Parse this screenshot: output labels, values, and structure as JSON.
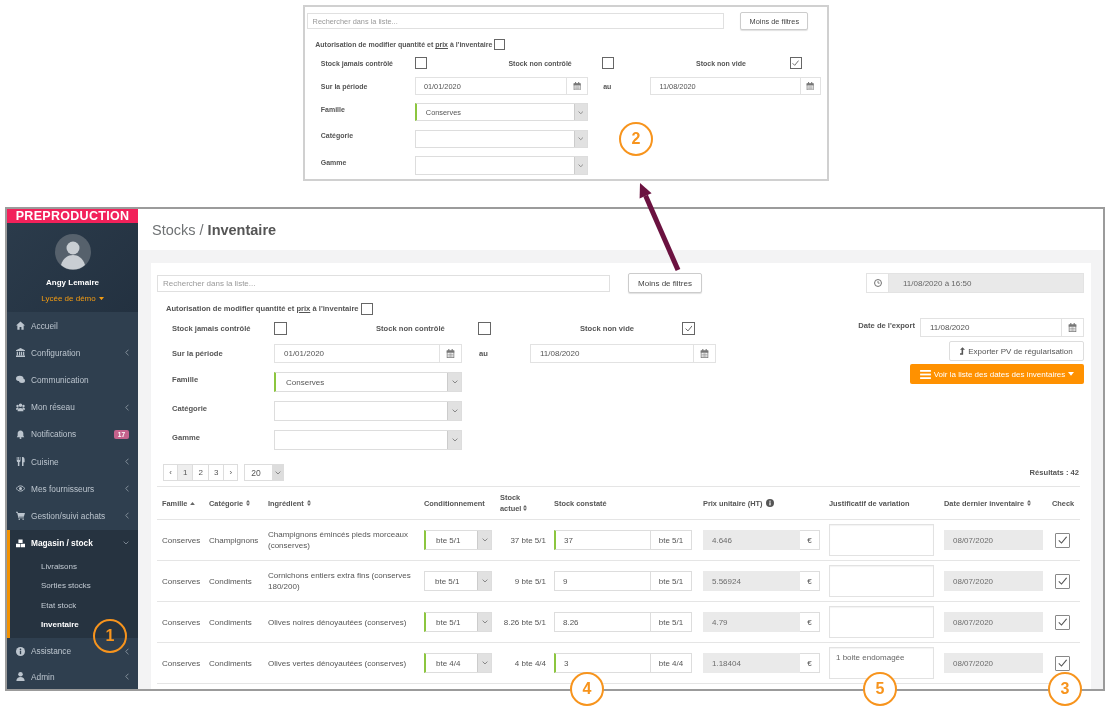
{
  "inset": {
    "filters": {
      "search": {
        "placeholder": "Rechercher dans la liste..."
      },
      "toggle_button": "Moins de filtres",
      "permission": {
        "parts": [
          {
            "text": "Autorisation de modifier quantité et",
            "underlined": false
          },
          {
            "text": "prix",
            "underlined": true
          },
          {
            "text": "à l'inventaire",
            "underlined": false
          }
        ],
        "checked": false
      },
      "stock_checks": [
        {
          "label": "Stock jamais contrôlé",
          "checked": false
        },
        {
          "label": "Stock non contrôlé",
          "checked": false
        },
        {
          "label": "Stock non vide",
          "checked": true
        }
      ],
      "period": {
        "label": "Sur la période",
        "from": "01/01/2020",
        "separator": "au",
        "to": "11/08/2020"
      },
      "selects": [
        {
          "label": "Famille",
          "value": "Conserves",
          "highlighted": true
        },
        {
          "label": "Catégorie",
          "highlighted": false
        },
        {
          "label": "Gamme",
          "highlighted": false
        }
      ]
    }
  },
  "sidebar": {
    "banner": "PREPRODUCTION",
    "user": {
      "name": "Angy Lemaire",
      "school": "Lycée de démo"
    },
    "items": [
      {
        "label": "Accueil",
        "kind": "link",
        "selected": false
      },
      {
        "label": "Configuration",
        "kind": "group",
        "expanded": false,
        "selected": false
      },
      {
        "label": "Communication",
        "kind": "link",
        "selected": false
      },
      {
        "label": "Mon réseau",
        "kind": "group",
        "expanded": false,
        "selected": false
      },
      {
        "label": "Notifications",
        "kind": "link",
        "selected": false,
        "badge": "17"
      },
      {
        "label": "Cuisine",
        "kind": "group",
        "expanded": false,
        "selected": false
      },
      {
        "label": "Mes fournisseurs",
        "kind": "group",
        "expanded": false,
        "selected": false
      },
      {
        "label": "Gestion/suivi achats",
        "kind": "group",
        "expanded": false,
        "selected": false
      },
      {
        "label": "Magasin / stock",
        "kind": "group",
        "expanded": true,
        "selected": true,
        "children": [
          {
            "label": "Livraisons",
            "selected": false
          },
          {
            "label": "Sorties stocks",
            "selected": false
          },
          {
            "label": "Etat stock",
            "selected": false
          },
          {
            "label": "Inventaire",
            "selected": true
          }
        ]
      },
      {
        "label": "Assistance",
        "kind": "group",
        "expanded": false,
        "selected": false
      },
      {
        "label": "Admin",
        "kind": "group",
        "expanded": false,
        "selected": false
      }
    ]
  },
  "main": {
    "breadcrumb": "Stocks / **Inventaire**",
    "filters": {
      "search": {
        "placeholder": "Rechercher dans la liste..."
      },
      "toggle_button": "Moins de filtres",
      "permission": {
        "parts": [
          {
            "text": "Autorisation de modifier quantité et",
            "underlined": false
          },
          {
            "text": "prix",
            "underlined": true
          },
          {
            "text": "à l'inventaire",
            "underlined": false
          }
        ],
        "checked": false
      },
      "stock_checks": [
        {
          "label": "Stock jamais contrôlé",
          "checked": false
        },
        {
          "label": "Stock non contrôlé",
          "checked": false
        },
        {
          "label": "Stock non vide",
          "checked": true
        }
      ],
      "period": {
        "label": "Sur la période",
        "from": "01/01/2020",
        "separator": "au",
        "to": "11/08/2020"
      },
      "selects": [
        {
          "label": "Famille",
          "value": "Conserves",
          "highlighted": true
        },
        {
          "label": "Catégorie",
          "highlighted": false
        },
        {
          "label": "Gamme",
          "highlighted": false
        }
      ]
    },
    "timestamp": {
      "value": "11/08/2020 à 16:50",
      "disabled": true
    },
    "export": {
      "label": "Date de l'export",
      "date": "11/08/2020",
      "button": "Exporter PV de régularisation"
    },
    "dates_button": "Voir la liste des dates des inventaires",
    "pagination": {
      "pages": [
        {
          "label": "‹",
          "selected": false
        },
        {
          "label": "1",
          "selected": true
        },
        {
          "label": "2",
          "selected": false
        },
        {
          "label": "3",
          "selected": false
        },
        {
          "label": "›",
          "selected": false
        }
      ],
      "page_size": "20"
    },
    "results": "Résultats : 42",
    "table": {
      "columns": [
        {
          "label": "Famille",
          "sortable": true,
          "sorted": true
        },
        {
          "label": "Catégorie",
          "sortable": true,
          "sorted": false
        },
        {
          "label": "Ingrédient",
          "sortable": true,
          "sorted": false
        },
        {
          "label": "Conditionnement"
        },
        {
          "label": "Stock actuel",
          "sortable": true,
          "sorted": false
        },
        {
          "label": "Stock constaté"
        },
        {
          "label": "Prix unitaire (HT)",
          "info": true
        },
        {
          "label": "Justificatif de variation"
        },
        {
          "label": "Date dernier inventaire",
          "sortable": true,
          "sorted": false
        },
        {
          "label": "Check"
        }
      ],
      "rows": [
        {
          "family": "Conserves",
          "category": "Champignons",
          "ingredient": "Champignons émincés pieds morceaux (conserves)",
          "packaging": {
            "value": "bte 5/1",
            "highlighted": true
          },
          "current_stock": "37 bte 5/1",
          "counted": {
            "value": "37",
            "unit": "bte 5/1",
            "highlighted": true
          },
          "unit_price": {
            "value": "4.646",
            "currency": "€",
            "disabled": true
          },
          "last_inventory": {
            "value": "08/07/2020",
            "disabled": true
          },
          "checked": true
        },
        {
          "family": "Conserves",
          "category": "Condiments",
          "ingredient": "Cornichons entiers extra fins (conserves 180/200)",
          "packaging": {
            "value": "bte 5/1",
            "highlighted": false
          },
          "current_stock": "9 bte 5/1",
          "counted": {
            "value": "9",
            "unit": "bte 5/1",
            "highlighted": false
          },
          "unit_price": {
            "value": "5.56924",
            "currency": "€",
            "disabled": true
          },
          "last_inventory": {
            "value": "08/07/2020",
            "disabled": true
          },
          "checked": true
        },
        {
          "family": "Conserves",
          "category": "Condiments",
          "ingredient": "Olives noires dénoyautées (conserves)",
          "packaging": {
            "value": "bte 5/1",
            "highlighted": true
          },
          "current_stock": "8.26 bte 5/1",
          "counted": {
            "value": "8.26",
            "unit": "bte 5/1",
            "highlighted": false
          },
          "unit_price": {
            "value": "4.79",
            "currency": "€",
            "disabled": true
          },
          "last_inventory": {
            "value": "08/07/2020",
            "disabled": true
          },
          "checked": true
        },
        {
          "family": "Conserves",
          "category": "Condiments",
          "ingredient": "Olives vertes dénoyautées (conserves)",
          "packaging": {
            "value": "bte 4/4",
            "highlighted": true
          },
          "current_stock": "4 bte 4/4",
          "counted": {
            "value": "3",
            "unit": "bte 4/4",
            "highlighted": true
          },
          "unit_price": {
            "value": "1.18404",
            "currency": "€",
            "disabled": true
          },
          "justification": "1 boite endomagée",
          "last_inventory": {
            "value": "08/07/2020",
            "disabled": true
          },
          "checked": true
        }
      ]
    }
  },
  "annotations": {
    "markers": [
      "2",
      "1",
      "4",
      "5",
      "3"
    ],
    "callout_arrow": true
  }
}
